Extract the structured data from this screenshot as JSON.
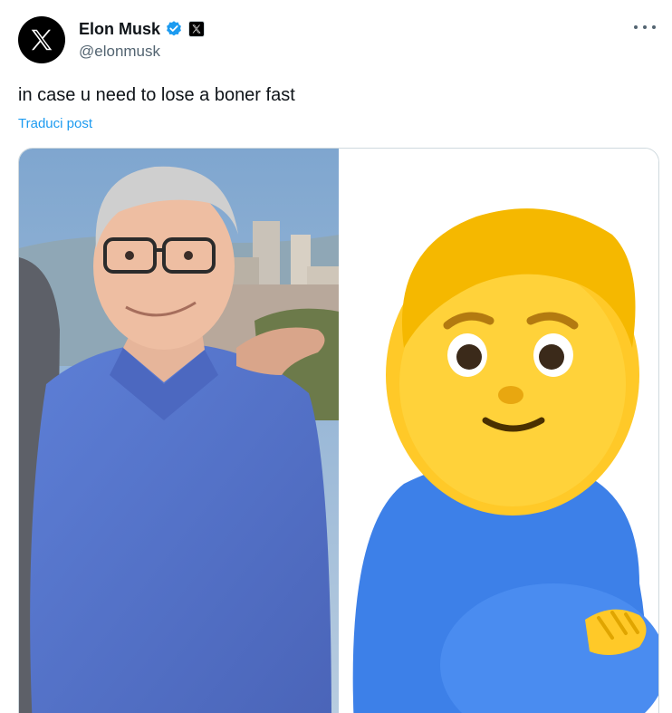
{
  "author": {
    "display_name": "Elon Musk",
    "handle": "@elonmusk",
    "avatar_icon": "x-logo-icon",
    "verified_icon": "verified-badge-icon",
    "affiliation_icon": "x-affiliation-icon"
  },
  "post": {
    "text": "in case u need to lose a boner fast",
    "translate_label": "Traduci post"
  },
  "media": {
    "left_image": "photo-man-blue-polo",
    "right_image": "pregnant-man-emoji"
  },
  "colors": {
    "link": "#1d9bf0",
    "verified": "#1d9bf0",
    "text": "#0f1419",
    "secondary": "#536471",
    "border": "#cfd9de"
  }
}
